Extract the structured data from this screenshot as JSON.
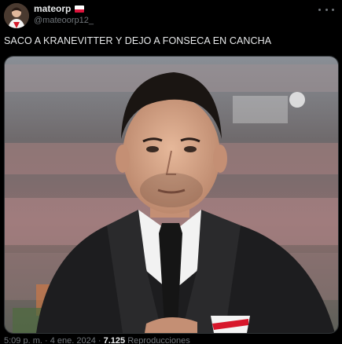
{
  "user": {
    "display_name": "mateorp",
    "handle": "@mateoorp12_",
    "flag": "poland-flag"
  },
  "tweet": {
    "text": "SACO A KRANEVITTER Y DEJO A FONSECA EN CANCHA"
  },
  "media": {
    "description_icon": "photo-man-in-suit-stadium",
    "badge": "river-plate-crest"
  },
  "meta": {
    "time": "5:09 p. m.",
    "date": "4 ene. 2024",
    "views_count": "7.125",
    "views_label": "Reproducciones"
  },
  "colors": {
    "background": "#000000",
    "text": "#e7e9ea",
    "muted": "#71767b",
    "border": "#2f3336"
  }
}
